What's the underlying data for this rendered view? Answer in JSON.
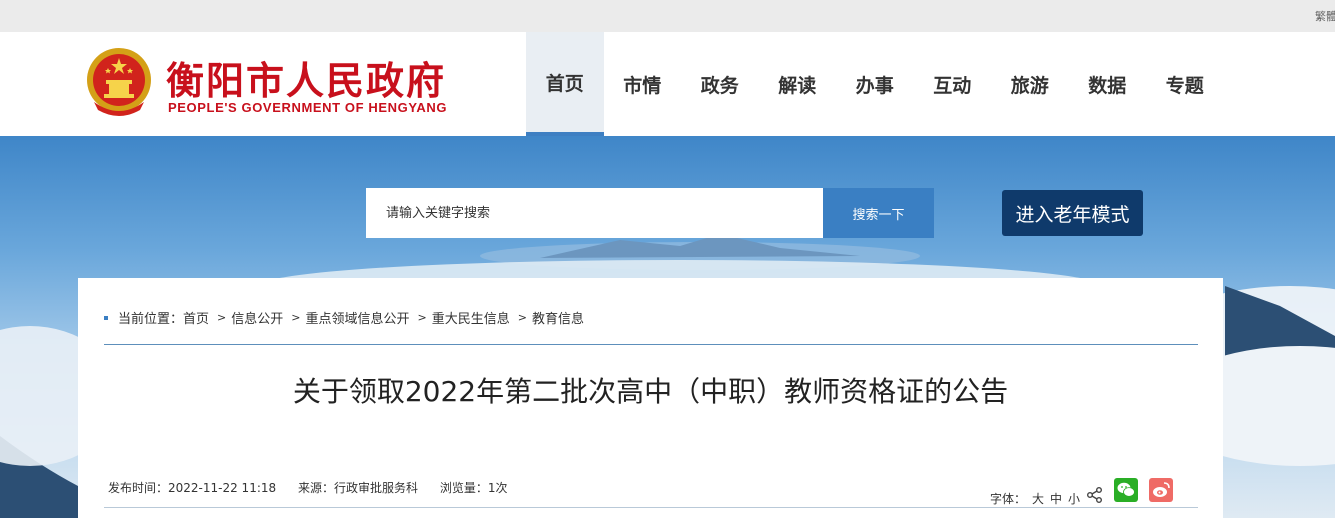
{
  "topbar": {
    "trad_label": "繁體"
  },
  "header": {
    "site_name": "衡阳市人民政府",
    "site_name_en": "PEOPLE'S GOVERNMENT OF HENGYANG",
    "nav": [
      "首页",
      "市情",
      "政务",
      "解读",
      "办事",
      "互动",
      "旅游",
      "数据",
      "专题"
    ],
    "active_nav": "首页"
  },
  "search": {
    "placeholder": "请输入关键字搜索",
    "button_label": "搜索一下"
  },
  "elder_mode": {
    "label": "进入老年模式"
  },
  "breadcrumb": {
    "prefix": "当前位置：",
    "items": [
      "首页",
      "信息公开",
      "重点领域信息公开",
      "重大民生信息",
      "教育信息"
    ]
  },
  "article": {
    "title": "关于领取2022年第二批次高中（中职）教师资格证的公告",
    "publish_time": "发布时间：2022-11-22 11:18",
    "source": "来源：行政审批服务科",
    "views": "浏览量：1次"
  },
  "font_size": {
    "label": "字体：",
    "large": "大",
    "medium": "中",
    "small": "小"
  },
  "colors": {
    "brand_red": "#c8101c",
    "accent_blue": "#3a7fc3",
    "elder_navy": "#0f3a6b",
    "wechat_green": "#2aae26",
    "weibo_red": "#ef6b66"
  },
  "icons": [
    "national-emblem-icon",
    "share-icon",
    "wechat-icon",
    "weibo-icon"
  ]
}
